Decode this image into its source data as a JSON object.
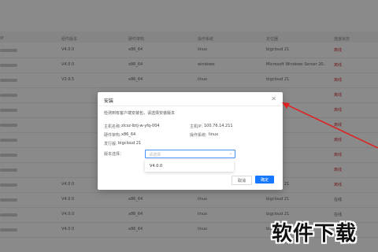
{
  "table": {
    "headers": [
      "IP",
      "组件版本",
      "硬件架构",
      "操作系统",
      "定位器",
      "连接状态"
    ],
    "rows": [
      {
        "version": "V4.0.0",
        "arch": "x86_64",
        "os": "linux",
        "loc": "bigcloud 21",
        "status": "离线"
      },
      {
        "version": "V4.0.0",
        "arch": "x86_64",
        "os": "windows",
        "loc": "Microsoft Windows Server 20..",
        "status": "离线"
      },
      {
        "version": "V3.9.5",
        "arch": "x86_64",
        "os": "linux",
        "loc": "bigcloud 21",
        "status": "离线"
      },
      {
        "version": "",
        "arch": "",
        "os": "",
        "loc": "",
        "status": "离线"
      },
      {
        "version": "",
        "arch": "",
        "os": "",
        "loc": "",
        "status": "离线"
      },
      {
        "version": "",
        "arch": "",
        "os": "",
        "loc": "",
        "status": "离线"
      },
      {
        "version": "",
        "arch": "",
        "os": "",
        "loc": "",
        "status": "离线"
      },
      {
        "version": "",
        "arch": "",
        "os": "",
        "loc": "",
        "status": "离线"
      },
      {
        "version": "",
        "arch": "",
        "os": "",
        "loc": "",
        "status": "离线"
      },
      {
        "version": "V4.0.0",
        "arch": "x86_64",
        "os": "linux",
        "loc": "bigcloud 21",
        "status": "离线"
      },
      {
        "version": "V4.0.0",
        "arch": "x86_64",
        "os": "linux",
        "loc": "bigcloud 21",
        "status": "在线"
      },
      {
        "version": "V4.0.0",
        "arch": "x86_64",
        "os": "linux",
        "loc": "bigcloud 21",
        "status": "在线"
      },
      {
        "version": "V4.0.0",
        "arch": "x86_64",
        "os": "linux",
        "loc": "bigcloud 21",
        "status": ""
      }
    ]
  },
  "dialog": {
    "title": "安装",
    "close_icon": "close-icon",
    "description": "检测到有客户端安装包，请选择安装版本",
    "host_label": "主机名称:",
    "host_value": "zlcsz-lbtj-w-yfq-004",
    "ip_label": "主机IP:",
    "ip_value": "100.76.14.211",
    "arch_label": "硬件架构:",
    "arch_value": "x86_64",
    "os_label": "操作系统:",
    "os_value": "linux",
    "distro_label": "发行版:",
    "distro_value": "bigcloud 21",
    "version_label": "版本选择：",
    "select_placeholder": "请选择",
    "options": [
      "V4.0.0"
    ],
    "cancel_label": "取消",
    "confirm_label": "确定"
  },
  "colors": {
    "primary": "#1677ff",
    "danger": "#d9363e",
    "arrow": "#e02020"
  },
  "watermark": "软件下载"
}
